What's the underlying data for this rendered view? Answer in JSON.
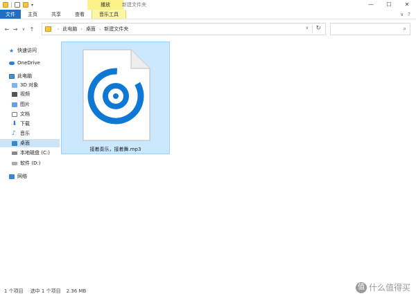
{
  "window": {
    "contextual_title": "播放",
    "title": "新建文件夹",
    "controls": [
      "—",
      "☐",
      "✕"
    ]
  },
  "ribbon": {
    "tabs": [
      {
        "label": "文件"
      },
      {
        "label": "主页"
      },
      {
        "label": "共享"
      },
      {
        "label": "查看"
      },
      {
        "label": "音乐工具"
      }
    ],
    "expand_glyph": "∨",
    "help_glyph": "?"
  },
  "nav": {
    "back": "←",
    "forward": "→",
    "recent": "∨",
    "up": "↑"
  },
  "address": {
    "breadcrumb": [
      "此电脑",
      "桌面",
      "新建文件夹"
    ],
    "separator": "›",
    "dropdown": "∨",
    "refresh": "↻"
  },
  "search": {
    "placeholder": "",
    "icon": "⌕"
  },
  "sidebar": {
    "items": [
      {
        "label": "快速访问",
        "icon": "star-icon"
      },
      {
        "label": "OneDrive",
        "icon": "cloud-icon"
      },
      {
        "label": "此电脑",
        "icon": "pc-icon"
      },
      {
        "label": "3D 对象",
        "icon": "3d-objects-icon"
      },
      {
        "label": "视频",
        "icon": "video-icon"
      },
      {
        "label": "图片",
        "icon": "pictures-icon"
      },
      {
        "label": "文档",
        "icon": "documents-icon"
      },
      {
        "label": "下载",
        "icon": "download-icon"
      },
      {
        "label": "音乐",
        "icon": "music-icon"
      },
      {
        "label": "桌面",
        "icon": "desktop-icon",
        "selected": true
      },
      {
        "label": "本地磁盘 (C:)",
        "icon": "drive-icon"
      },
      {
        "label": "软件 (D:)",
        "icon": "drive-icon"
      },
      {
        "label": "网络",
        "icon": "network-icon"
      }
    ]
  },
  "files": [
    {
      "name": "接着奏乐，接着舞.mp3",
      "icon": "groove-music-file-icon",
      "selected": true
    }
  ],
  "status": {
    "count": "1 个项目",
    "selected": "选中 1 个项目",
    "size": "2.36 MB"
  },
  "watermark": {
    "badge": "值",
    "text": "什么值得买"
  },
  "colors": {
    "accent": "#1e6fc2",
    "music_tools": "#fdf6a6",
    "selection": "#cce8ff",
    "groove_blue": "#0f78d4"
  }
}
